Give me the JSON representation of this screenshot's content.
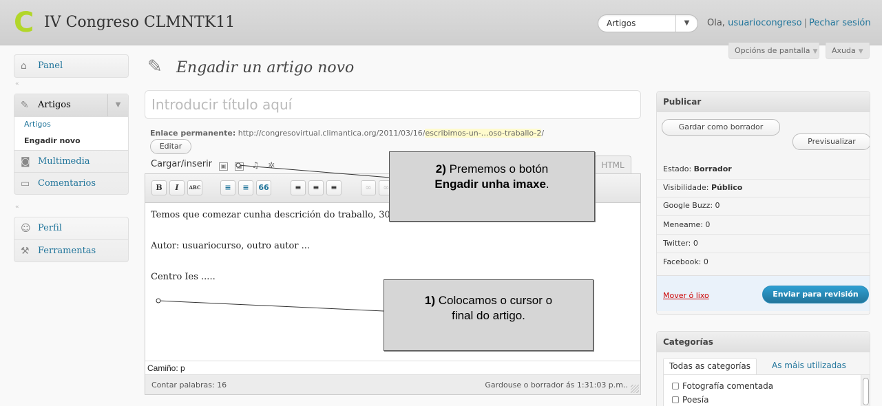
{
  "header": {
    "site_title": "IV Congreso CLMNTK11",
    "logo_letter": "C",
    "favorite_select": "Artigos",
    "greeting": "Ola,",
    "username": "usuariocongreso",
    "logout": "Pechar sesión"
  },
  "screen_meta": {
    "options": "Opcións de pantalla",
    "help": "Axuda"
  },
  "sidebar": {
    "panel": "Panel",
    "posts": "Artigos",
    "posts_sub": [
      "Artigos",
      "Engadir novo"
    ],
    "media": "Multimedia",
    "comments": "Comentarios",
    "profile": "Perfil",
    "tools": "Ferramentas"
  },
  "main": {
    "page_title": "Engadir un artigo novo",
    "title_placeholder": "Introducir título aquí",
    "permalink_label": "Enlace permanente:",
    "permalink_base": "http://congresovirtual.climantica.org/2011/03/16/",
    "permalink_slug": "escribimos-un-…oso-traballo-2",
    "permalink_end": "/",
    "edit_button": "Editar",
    "upload_label": "Cargar/inserir",
    "html_tab": "HTML",
    "toolbar": [
      "B",
      "I",
      "ABC",
      "≡",
      "≡",
      "66",
      "≡",
      "≡",
      "≡",
      "∞",
      "∞"
    ],
    "content": [
      "Temos que comezar cunha descrición do traballo, 30",
      "Autor: usuariocurso, outro autor ...",
      "Centro Ies ....."
    ],
    "path_label": "Camiño: p",
    "word_count": "Contar palabras: 16",
    "autosave": "Gardouse o borrador ás 1:31:03 p.m.."
  },
  "callouts": {
    "c2_num": "2)",
    "c2_text": "Prememos o botón",
    "c2_bold": "Engadir unha imaxe",
    "c2_end": ".",
    "c1_num": "1)",
    "c1_text": "Colocamos o cursor o",
    "c1_text2": "final do artigo."
  },
  "publish": {
    "heading": "Publicar",
    "save_draft": "Gardar como borrador",
    "preview": "Previsualizar",
    "status_label": "Estado:",
    "status_value": "Borrador",
    "visibility_label": "Visibilidade:",
    "visibility_value": "Público",
    "google_buzz": "Google Buzz: 0",
    "meneame": "Meneame: 0",
    "twitter": "Twitter: 0",
    "facebook": "Facebook: 0",
    "trash": "Mover ó lixo",
    "submit": "Enviar para revisión"
  },
  "categories": {
    "heading": "Categorías",
    "tab_all": "Todas as categorías",
    "tab_popular": "As máis utilizadas",
    "items": [
      "Fotografía comentada",
      "Poesía"
    ]
  }
}
